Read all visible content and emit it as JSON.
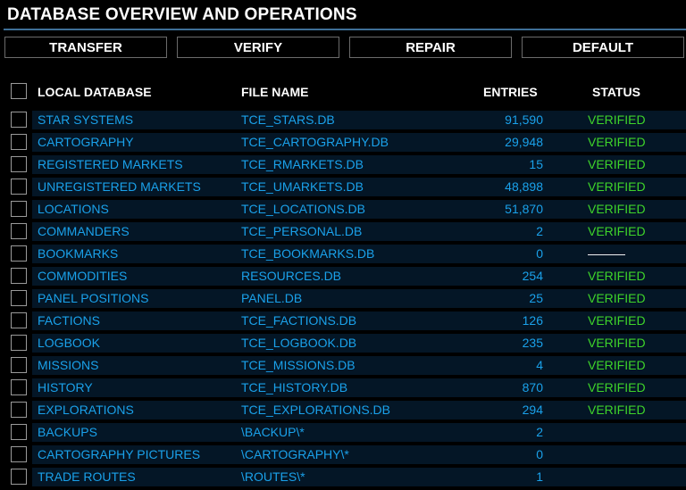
{
  "title": "DATABASE OVERVIEW AND OPERATIONS",
  "buttons": {
    "transfer": "TRANSFER",
    "verify": "VERIFY",
    "repair": "REPAIR",
    "default": "DEFAULT"
  },
  "headers": {
    "database": "LOCAL DATABASE",
    "file": "FILE NAME",
    "entries": "ENTRIES",
    "status": "STATUS"
  },
  "rows": [
    {
      "name": "STAR SYSTEMS",
      "file": "TCE_STARS.DB",
      "entries": "91,590",
      "status": "VERIFIED"
    },
    {
      "name": "CARTOGRAPHY",
      "file": "TCE_CARTOGRAPHY.DB",
      "entries": "29,948",
      "status": "VERIFIED"
    },
    {
      "name": "REGISTERED MARKETS",
      "file": "TCE_RMARKETS.DB",
      "entries": "15",
      "status": "VERIFIED"
    },
    {
      "name": "UNREGISTERED MARKETS",
      "file": "TCE_UMARKETS.DB",
      "entries": "48,898",
      "status": "VERIFIED"
    },
    {
      "name": "LOCATIONS",
      "file": "TCE_LOCATIONS.DB",
      "entries": "51,870",
      "status": "VERIFIED"
    },
    {
      "name": "COMMANDERS",
      "file": "TCE_PERSONAL.DB",
      "entries": "2",
      "status": "VERIFIED"
    },
    {
      "name": "BOOKMARKS",
      "file": "TCE_BOOKMARKS.DB",
      "entries": "0",
      "status": "———"
    },
    {
      "name": "COMMODITIES",
      "file": "RESOURCES.DB",
      "entries": "254",
      "status": "VERIFIED"
    },
    {
      "name": "PANEL POSITIONS",
      "file": "PANEL.DB",
      "entries": "25",
      "status": "VERIFIED"
    },
    {
      "name": "FACTIONS",
      "file": "TCE_FACTIONS.DB",
      "entries": "126",
      "status": "VERIFIED"
    },
    {
      "name": "LOGBOOK",
      "file": "TCE_LOGBOOK.DB",
      "entries": "235",
      "status": "VERIFIED"
    },
    {
      "name": "MISSIONS",
      "file": "TCE_MISSIONS.DB",
      "entries": "4",
      "status": "VERIFIED"
    },
    {
      "name": "HISTORY",
      "file": "TCE_HISTORY.DB",
      "entries": "870",
      "status": "VERIFIED"
    },
    {
      "name": "EXPLORATIONS",
      "file": "TCE_EXPLORATIONS.DB",
      "entries": "294",
      "status": "VERIFIED"
    },
    {
      "name": "BACKUPS",
      "file": "\\BACKUP\\*",
      "entries": "2",
      "status": ""
    },
    {
      "name": "CARTOGRAPHY PICTURES",
      "file": "\\CARTOGRAPHY\\*",
      "entries": "0",
      "status": ""
    },
    {
      "name": "TRADE ROUTES",
      "file": "\\ROUTES\\*",
      "entries": "1",
      "status": ""
    }
  ]
}
